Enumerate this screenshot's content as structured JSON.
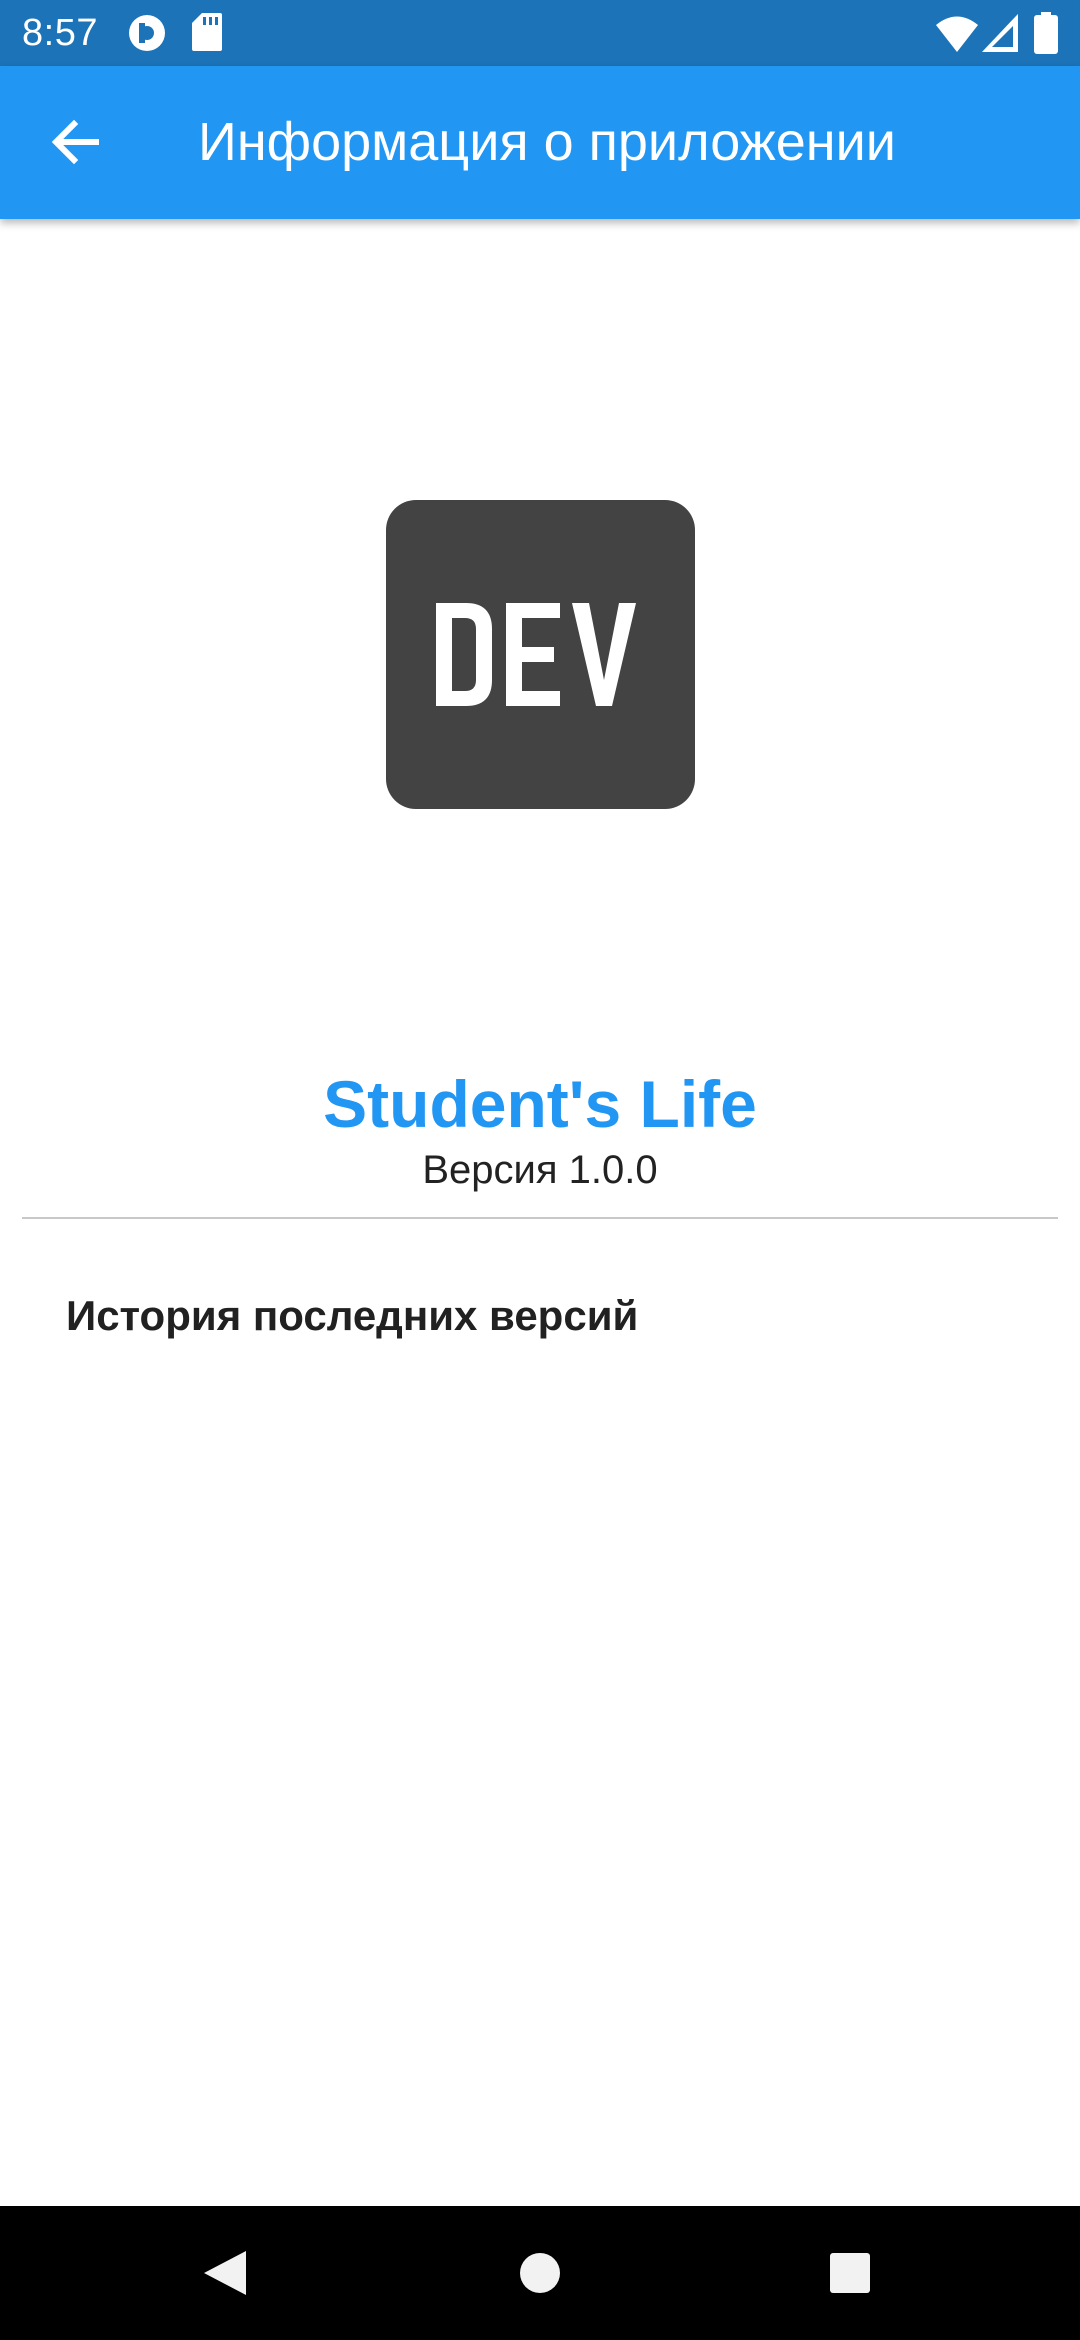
{
  "status_bar": {
    "time": "8:57",
    "icons": [
      "pocket-casts-icon",
      "sd-card-icon",
      "wifi-icon",
      "signal-icon",
      "battery-icon"
    ]
  },
  "app_bar": {
    "back_icon": "arrow-back-icon",
    "title": "Информация о приложении"
  },
  "logo": {
    "text": "DEV",
    "background_color": "#434343"
  },
  "app_info": {
    "name": "Student's Life",
    "version": "Версия 1.0.0"
  },
  "history": {
    "heading": "История последних версий"
  },
  "nav_bar": {
    "icons": [
      "back-triangle-icon",
      "home-circle-icon",
      "recents-square-icon"
    ]
  },
  "colors": {
    "status_bar": "#1c73b8",
    "app_bar": "#2196f3",
    "accent": "#2196f3",
    "logo_background": "#434343",
    "nav_bar": "#000000"
  }
}
